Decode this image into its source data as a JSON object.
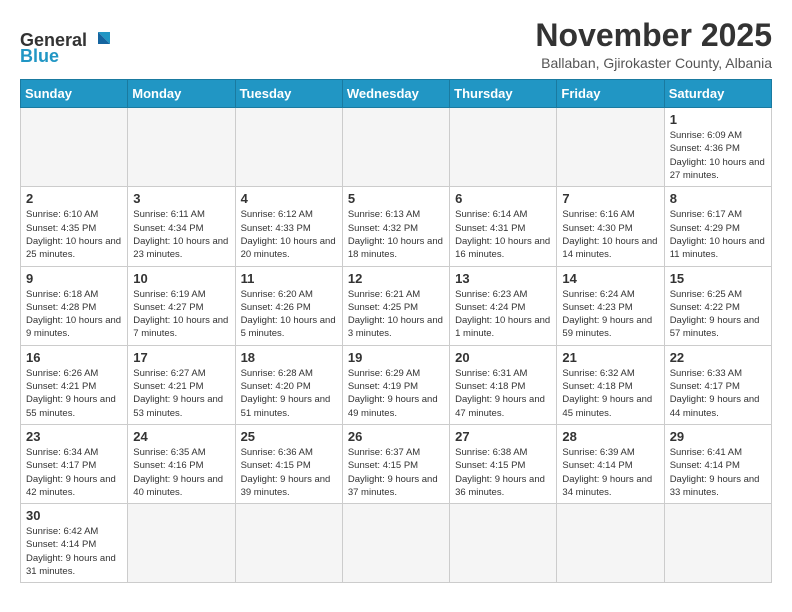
{
  "logo": {
    "text_general": "General",
    "text_blue": "Blue"
  },
  "header": {
    "title": "November 2025",
    "subtitle": "Ballaban, Gjirokaster County, Albania"
  },
  "weekdays": [
    "Sunday",
    "Monday",
    "Tuesday",
    "Wednesday",
    "Thursday",
    "Friday",
    "Saturday"
  ],
  "weeks": [
    [
      {
        "day": "",
        "info": ""
      },
      {
        "day": "",
        "info": ""
      },
      {
        "day": "",
        "info": ""
      },
      {
        "day": "",
        "info": ""
      },
      {
        "day": "",
        "info": ""
      },
      {
        "day": "",
        "info": ""
      },
      {
        "day": "1",
        "info": "Sunrise: 6:09 AM\nSunset: 4:36 PM\nDaylight: 10 hours and 27 minutes."
      }
    ],
    [
      {
        "day": "2",
        "info": "Sunrise: 6:10 AM\nSunset: 4:35 PM\nDaylight: 10 hours and 25 minutes."
      },
      {
        "day": "3",
        "info": "Sunrise: 6:11 AM\nSunset: 4:34 PM\nDaylight: 10 hours and 23 minutes."
      },
      {
        "day": "4",
        "info": "Sunrise: 6:12 AM\nSunset: 4:33 PM\nDaylight: 10 hours and 20 minutes."
      },
      {
        "day": "5",
        "info": "Sunrise: 6:13 AM\nSunset: 4:32 PM\nDaylight: 10 hours and 18 minutes."
      },
      {
        "day": "6",
        "info": "Sunrise: 6:14 AM\nSunset: 4:31 PM\nDaylight: 10 hours and 16 minutes."
      },
      {
        "day": "7",
        "info": "Sunrise: 6:16 AM\nSunset: 4:30 PM\nDaylight: 10 hours and 14 minutes."
      },
      {
        "day": "8",
        "info": "Sunrise: 6:17 AM\nSunset: 4:29 PM\nDaylight: 10 hours and 11 minutes."
      }
    ],
    [
      {
        "day": "9",
        "info": "Sunrise: 6:18 AM\nSunset: 4:28 PM\nDaylight: 10 hours and 9 minutes."
      },
      {
        "day": "10",
        "info": "Sunrise: 6:19 AM\nSunset: 4:27 PM\nDaylight: 10 hours and 7 minutes."
      },
      {
        "day": "11",
        "info": "Sunrise: 6:20 AM\nSunset: 4:26 PM\nDaylight: 10 hours and 5 minutes."
      },
      {
        "day": "12",
        "info": "Sunrise: 6:21 AM\nSunset: 4:25 PM\nDaylight: 10 hours and 3 minutes."
      },
      {
        "day": "13",
        "info": "Sunrise: 6:23 AM\nSunset: 4:24 PM\nDaylight: 10 hours and 1 minute."
      },
      {
        "day": "14",
        "info": "Sunrise: 6:24 AM\nSunset: 4:23 PM\nDaylight: 9 hours and 59 minutes."
      },
      {
        "day": "15",
        "info": "Sunrise: 6:25 AM\nSunset: 4:22 PM\nDaylight: 9 hours and 57 minutes."
      }
    ],
    [
      {
        "day": "16",
        "info": "Sunrise: 6:26 AM\nSunset: 4:21 PM\nDaylight: 9 hours and 55 minutes."
      },
      {
        "day": "17",
        "info": "Sunrise: 6:27 AM\nSunset: 4:21 PM\nDaylight: 9 hours and 53 minutes."
      },
      {
        "day": "18",
        "info": "Sunrise: 6:28 AM\nSunset: 4:20 PM\nDaylight: 9 hours and 51 minutes."
      },
      {
        "day": "19",
        "info": "Sunrise: 6:29 AM\nSunset: 4:19 PM\nDaylight: 9 hours and 49 minutes."
      },
      {
        "day": "20",
        "info": "Sunrise: 6:31 AM\nSunset: 4:18 PM\nDaylight: 9 hours and 47 minutes."
      },
      {
        "day": "21",
        "info": "Sunrise: 6:32 AM\nSunset: 4:18 PM\nDaylight: 9 hours and 45 minutes."
      },
      {
        "day": "22",
        "info": "Sunrise: 6:33 AM\nSunset: 4:17 PM\nDaylight: 9 hours and 44 minutes."
      }
    ],
    [
      {
        "day": "23",
        "info": "Sunrise: 6:34 AM\nSunset: 4:17 PM\nDaylight: 9 hours and 42 minutes."
      },
      {
        "day": "24",
        "info": "Sunrise: 6:35 AM\nSunset: 4:16 PM\nDaylight: 9 hours and 40 minutes."
      },
      {
        "day": "25",
        "info": "Sunrise: 6:36 AM\nSunset: 4:15 PM\nDaylight: 9 hours and 39 minutes."
      },
      {
        "day": "26",
        "info": "Sunrise: 6:37 AM\nSunset: 4:15 PM\nDaylight: 9 hours and 37 minutes."
      },
      {
        "day": "27",
        "info": "Sunrise: 6:38 AM\nSunset: 4:15 PM\nDaylight: 9 hours and 36 minutes."
      },
      {
        "day": "28",
        "info": "Sunrise: 6:39 AM\nSunset: 4:14 PM\nDaylight: 9 hours and 34 minutes."
      },
      {
        "day": "29",
        "info": "Sunrise: 6:41 AM\nSunset: 4:14 PM\nDaylight: 9 hours and 33 minutes."
      }
    ],
    [
      {
        "day": "30",
        "info": "Sunrise: 6:42 AM\nSunset: 4:14 PM\nDaylight: 9 hours and 31 minutes."
      },
      {
        "day": "",
        "info": ""
      },
      {
        "day": "",
        "info": ""
      },
      {
        "day": "",
        "info": ""
      },
      {
        "day": "",
        "info": ""
      },
      {
        "day": "",
        "info": ""
      },
      {
        "day": "",
        "info": ""
      }
    ]
  ]
}
